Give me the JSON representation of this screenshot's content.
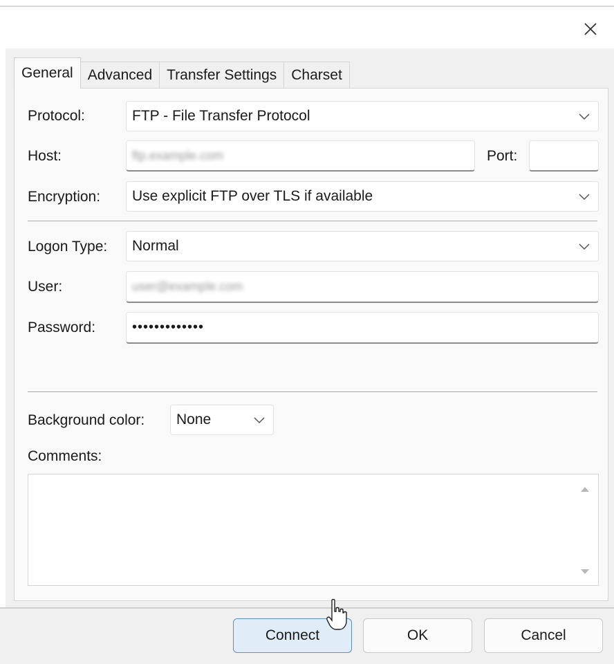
{
  "tabs": [
    {
      "label": "General"
    },
    {
      "label": "Advanced"
    },
    {
      "label": "Transfer Settings"
    },
    {
      "label": "Charset"
    }
  ],
  "general": {
    "protocol_label": "Protocol:",
    "protocol_value": "FTP - File Transfer Protocol",
    "host_label": "Host:",
    "host_value": "ftp.example.com",
    "port_label": "Port:",
    "port_value": "",
    "encryption_label": "Encryption:",
    "encryption_value": "Use explicit FTP over TLS if available",
    "logon_type_label": "Logon Type:",
    "logon_type_value": "Normal",
    "user_label": "User:",
    "user_value": "user@example.com",
    "password_label": "Password:",
    "password_value": "•••••••••••••",
    "background_color_label": "Background color:",
    "background_color_value": "None",
    "comments_label": "Comments:",
    "comments_value": ""
  },
  "footer": {
    "connect_label": "Connect",
    "ok_label": "OK",
    "cancel_label": "Cancel"
  },
  "icons": {
    "close": "close-icon",
    "chevron": "chevron-down-icon",
    "scroll_up": "scroll-up-arrow-icon",
    "scroll_down": "scroll-down-arrow-icon",
    "cursor": "mouse-cursor-icon"
  },
  "colors": {
    "primary_button_bg": "#e0ecf7",
    "primary_button_border": "#5f8fbf",
    "panel_bg": "#f9f9f9",
    "dialog_bg": "#f0f0f0"
  }
}
